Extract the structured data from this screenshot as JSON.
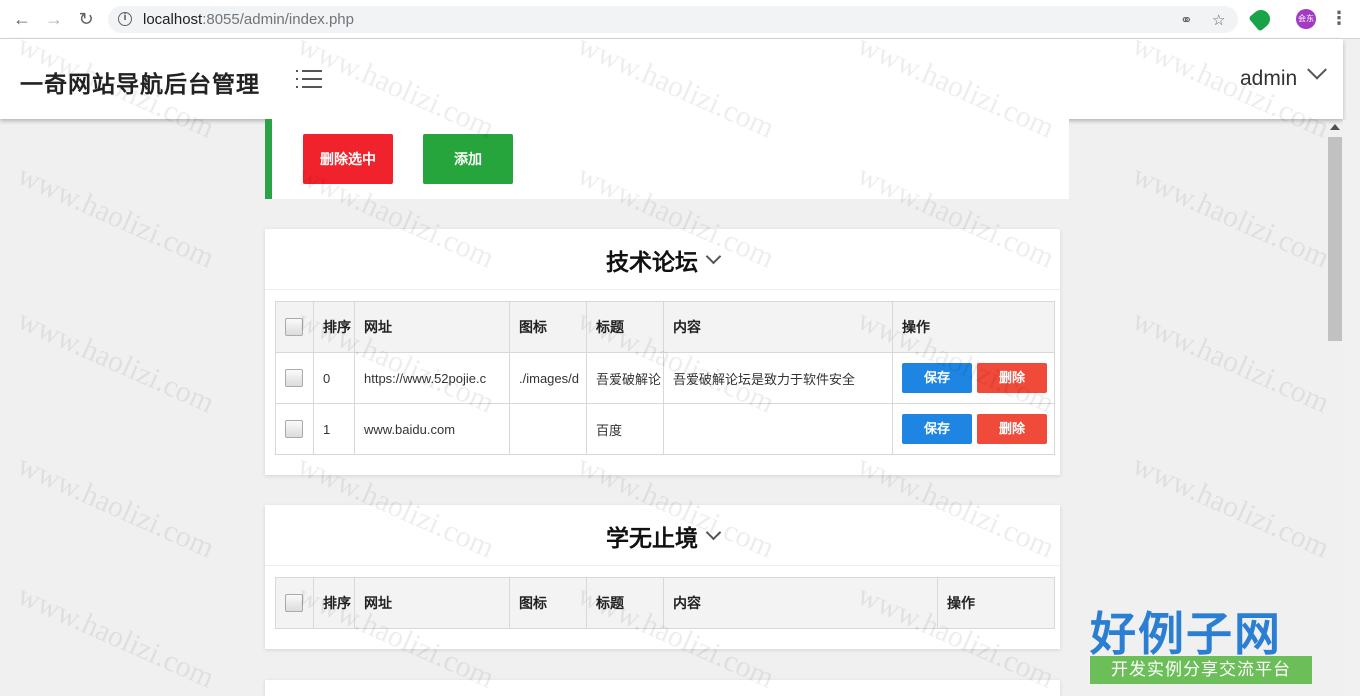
{
  "browser": {
    "url_host": "localhost",
    "url_rest": ":8055/admin/index.php",
    "profile_text": "会东"
  },
  "header": {
    "site_title": "一奇网站导航后台管理",
    "user": "admin"
  },
  "toolbar": {
    "delete_selected": "删除选中",
    "add": "添加"
  },
  "columns": {
    "order": "排序",
    "url": "网址",
    "icon": "图标",
    "title": "标题",
    "content": "内容",
    "actions": "操作"
  },
  "buttons": {
    "save": "保存",
    "delete": "删除"
  },
  "categories": [
    {
      "title": "技术论坛",
      "rows": [
        {
          "order": "0",
          "url": "https://www.52pojie.c",
          "icon": "./images/d",
          "title": "吾爱破解论",
          "content": "吾爱破解论坛是致力于软件安全"
        },
        {
          "order": "1",
          "url": "www.baidu.com",
          "icon": "",
          "title": "百度",
          "content": ""
        }
      ]
    },
    {
      "title": "学无止境",
      "rows": []
    }
  ],
  "watermark": "www.haolizi.com",
  "logo": {
    "main": "好例子网",
    "tagline": "开发实例分享交流平台"
  },
  "colors": {
    "delete_red": "#f0232c",
    "add_green": "#25a53b",
    "save_blue": "#1e86e2",
    "row_delete_red": "#f04a3b",
    "accent_bar": "#2ba245"
  }
}
